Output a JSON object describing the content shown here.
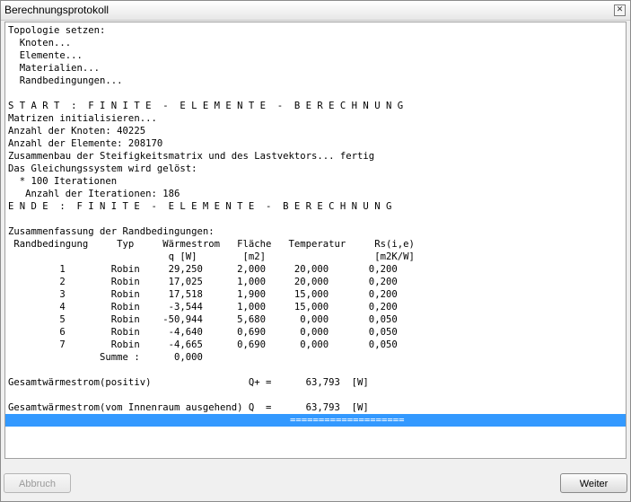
{
  "window": {
    "title": "Berechnungsprotokoll",
    "close_glyph": "✕"
  },
  "log_lines": [
    "Topologie setzen:",
    "  Knoten...",
    "  Elemente...",
    "  Materialien...",
    "  Randbedingungen...",
    "",
    "S T A R T  :  F I N I T E  -  E L E M E N T E  -  B E R E C H N U N G",
    "Matrizen initialisieren...",
    "Anzahl der Knoten: 40225",
    "Anzahl der Elemente: 208170",
    "Zusammenbau der Steifigkeitsmatrix und des Lastvektors... fertig",
    "Das Gleichungssystem wird gelöst:",
    "  * 100 Iterationen",
    "   Anzahl der Iterationen: 186",
    "E N D E  :  F I N I T E  -  E L E M E N T E  -  B E R E C H N U N G",
    "",
    "Zusammenfassung der Randbedingungen:",
    " Randbedingung     Typ     Wärmestrom   Fläche   Temperatur     Rs(i,e)",
    "                            q [W]        [m2]                   [m2K/W]",
    "         1        Robin     29,250      2,000     20,000       0,200",
    "         2        Robin     17,025      1,000     20,000       0,200",
    "         3        Robin     17,518      1,900     15,000       0,200",
    "         4        Robin     -3,544      1,000     15,000       0,200",
    "         5        Robin    -50,944      5,680      0,000       0,050",
    "         6        Robin     -4,640      0,690      0,000       0,050",
    "         7        Robin     -4,665      0,690      0,000       0,050",
    "                Summe :      0,000",
    "",
    "Gesamtwärmestrom(positiv)                 Q+ =      63,793  [W]",
    "",
    "Gesamtwärmestrom(vom Innenraum ausgehend) Q  =      63,793  [W]"
  ],
  "highlight_line": "====================",
  "buttons": {
    "abbruch": "Abbruch",
    "weiter": "Weiter"
  },
  "colors": {
    "selection": "#3399ff"
  }
}
